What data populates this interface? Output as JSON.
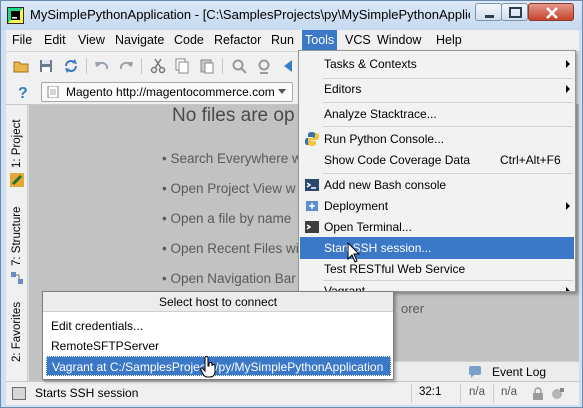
{
  "window": {
    "title": "MySimplePythonApplication - [C:\\SamplesProjects\\py\\MySimplePythonApplication] - ..."
  },
  "menubar": {
    "items": [
      {
        "label": "File"
      },
      {
        "label": "Edit"
      },
      {
        "label": "View"
      },
      {
        "label": "Navigate"
      },
      {
        "label": "Code"
      },
      {
        "label": "Refactor"
      },
      {
        "label": "Run"
      },
      {
        "label": "Tools",
        "active": true
      },
      {
        "label": "VCS"
      },
      {
        "label": "Window"
      },
      {
        "label": "Help"
      }
    ]
  },
  "navbar": {
    "server_label": "Magento http://magentocommerce.com"
  },
  "left_strip": {
    "project_tab": "1: Project",
    "structure_tab": "7: Structure",
    "favorites_tab": "2: Favorites"
  },
  "editor": {
    "empty_title": "No files are op",
    "hints": [
      "• Search Everywhere w",
      "• Open Project View w",
      "• Open a file by name",
      "• Open Recent Files wi",
      "• Open Navigation Bar"
    ],
    "hint_tail": "orer"
  },
  "tools_menu": {
    "items": [
      {
        "label": "Tasks & Contexts",
        "submenu": true
      },
      {
        "label": "Editors",
        "submenu": true
      },
      {
        "label": "Analyze Stacktrace..."
      },
      {
        "label": "Run Python Console...",
        "icon": "python-icon"
      },
      {
        "label": "Show Code Coverage Data",
        "shortcut": "Ctrl+Alt+F6"
      },
      {
        "label": "Add new Bash console",
        "icon": "bash-console-icon"
      },
      {
        "label": "Deployment",
        "submenu": true,
        "icon": "deployment-icon"
      },
      {
        "label": "Open Terminal...",
        "icon": "terminal-icon"
      },
      {
        "label": "Start SSH session...",
        "selected": true
      },
      {
        "label": "Test RESTful Web Service"
      },
      {
        "label": "Vagrant",
        "submenu": true
      }
    ]
  },
  "host_popup": {
    "title": "Select host to connect",
    "items": [
      {
        "label": "Edit credentials..."
      },
      {
        "label": "RemoteSFTPServer"
      },
      {
        "label": "Vagrant at C:/SamplesProjects/py/MySimplePythonApplication",
        "selected": true
      }
    ]
  },
  "statusbar": {
    "message": "Starts SSH session",
    "position": "32:1",
    "cell_a": "n/a",
    "cell_b": "n/a",
    "event_log": "Event Log"
  },
  "colors": {
    "selection": "#3b78c8",
    "editor_bg": "#c2c2c2",
    "menu_bg": "#f2f2f2"
  }
}
